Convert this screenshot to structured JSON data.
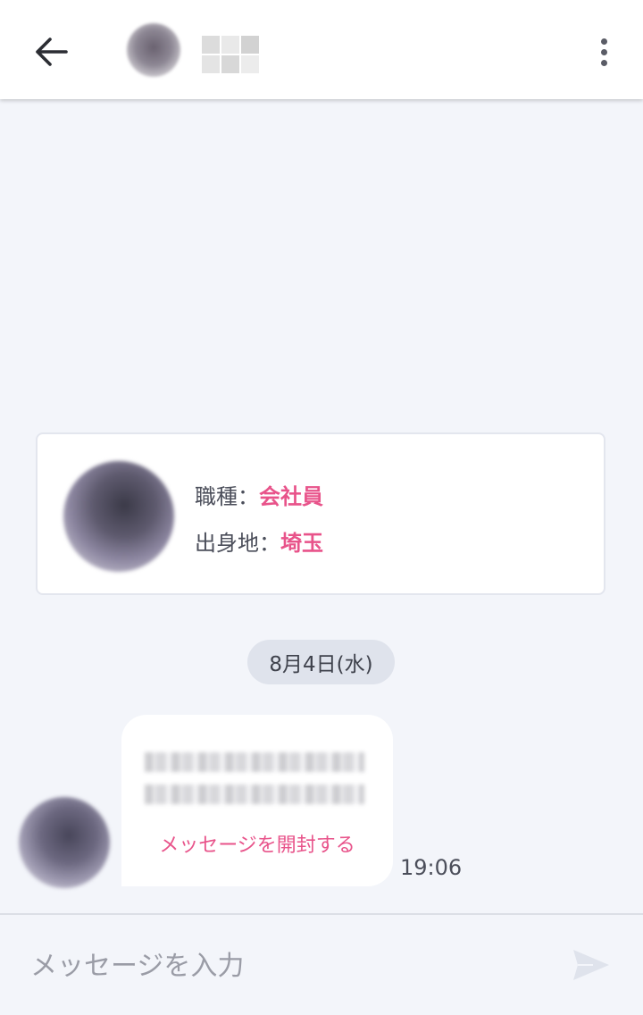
{
  "header": {
    "back_icon": "arrow-left-icon",
    "menu_icon": "more-vertical-icon"
  },
  "profile": {
    "job_label": "職種：",
    "job_value": "会社員",
    "hometown_label": "出身地：",
    "hometown_value": "埼玉"
  },
  "date_separator": "8月4日(水)",
  "message": {
    "open_link": "メッセージを開封する",
    "time": "19:06"
  },
  "composer": {
    "placeholder": "メッセージを入力",
    "send_icon": "send-icon"
  },
  "colors": {
    "accent": "#e8538a",
    "background": "#f3f5fa"
  }
}
